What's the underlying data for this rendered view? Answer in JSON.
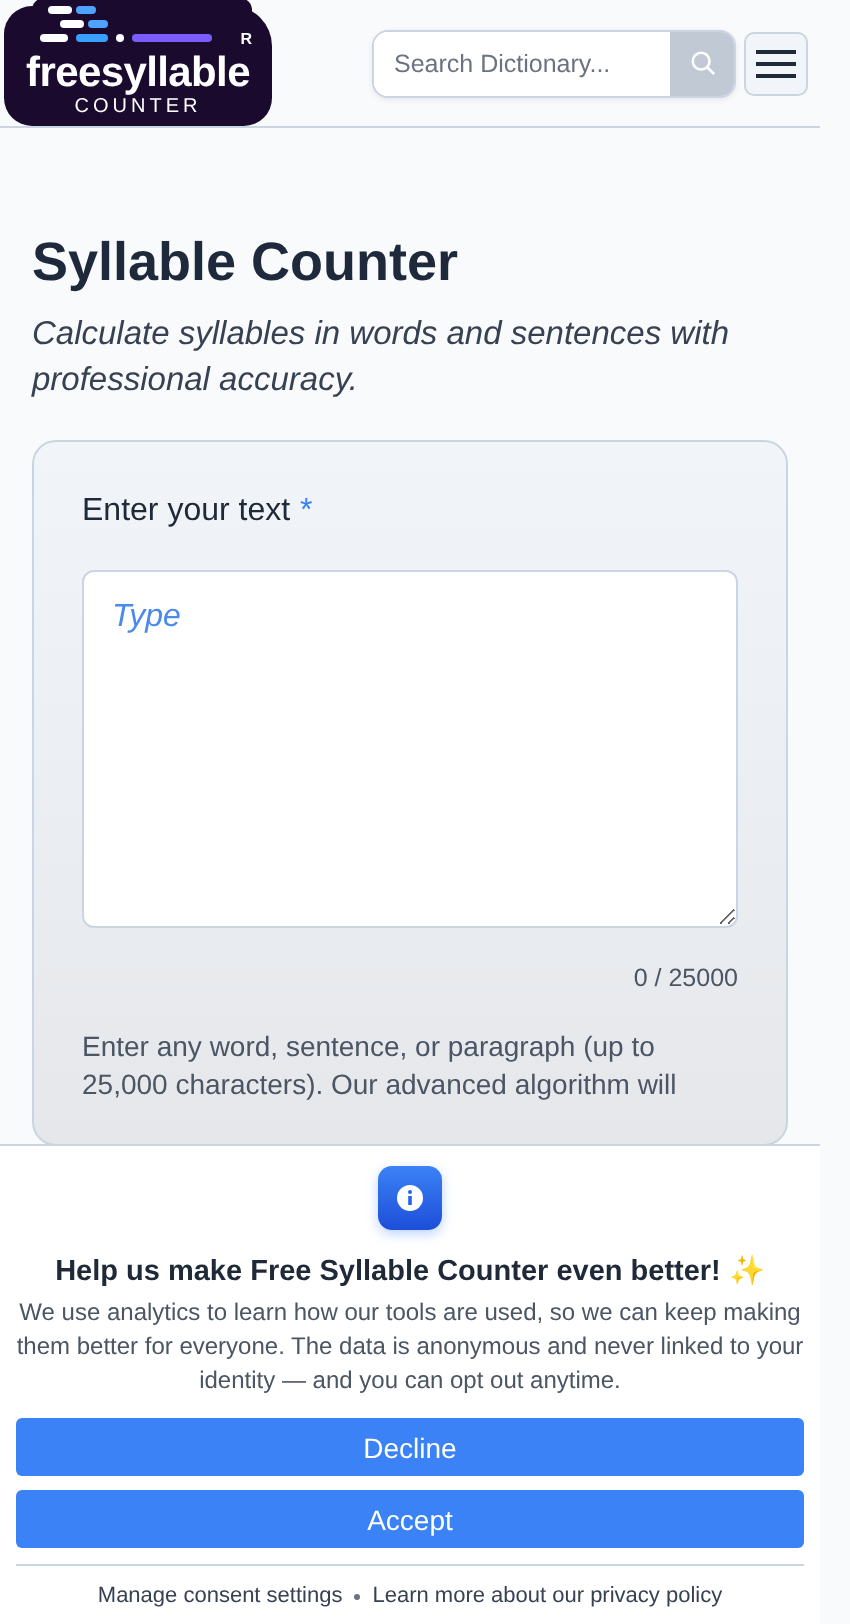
{
  "header": {
    "logo": {
      "wordmark": "freesyllable",
      "subtitle": "COUNTER",
      "registered": "R"
    },
    "search": {
      "placeholder": "Search Dictionary..."
    }
  },
  "page": {
    "title": "Syllable Counter",
    "subtitle": "Calculate syllables in words and sentences with professional accuracy."
  },
  "form": {
    "label": "Enter your text",
    "required_mark": "*",
    "textarea": {
      "placeholder": "Type"
    },
    "counter": "0 / 25000",
    "help": "Enter any word, sentence, or paragraph (up to 25,000 characters). Our advanced algorithm will"
  },
  "consent": {
    "title": "Help us make Free Syllable Counter even better! ✨",
    "text": "We use analytics to learn how our tools are used, so we can keep making them better for everyone. The data is anonymous and never linked to your identity — and you can opt out anytime.",
    "buttons": [
      {
        "label": "Decline"
      },
      {
        "label": "Accept"
      }
    ],
    "links": [
      {
        "label": "Manage consent settings"
      },
      {
        "label": "Learn more about our privacy policy"
      }
    ]
  }
}
